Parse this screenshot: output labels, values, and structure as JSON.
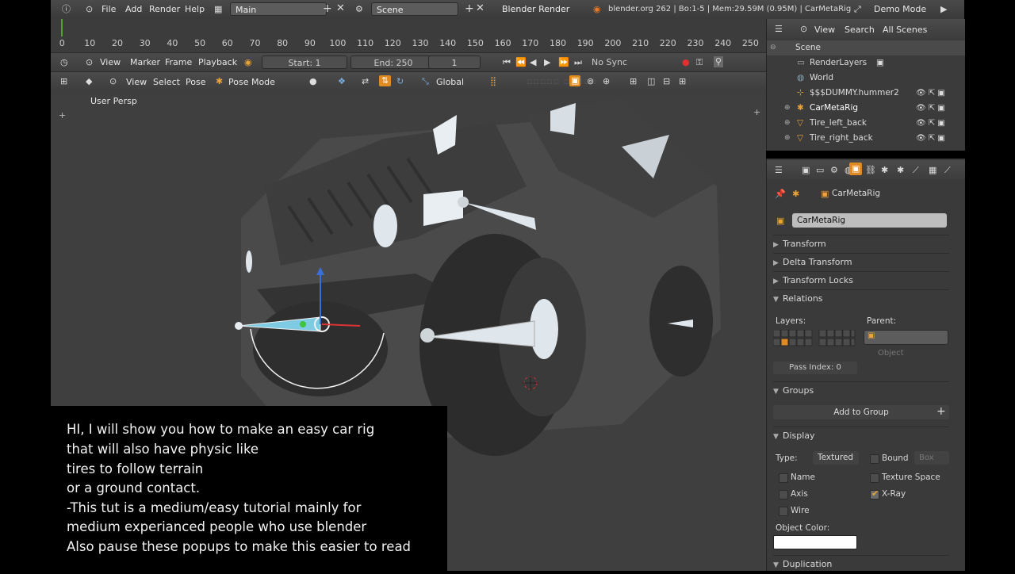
{
  "topbar": {
    "menus": [
      "File",
      "Add",
      "Render",
      "Help"
    ],
    "screen_layout": "Main",
    "scene": "Scene",
    "render_engine": "Blender Render",
    "stats": "blender.org 262 | Bo:1-5 | Mem:29.59M (0.95M) | CarMetaRig",
    "mode_label": "Demo Mode"
  },
  "timeline": {
    "ticks": [
      "0",
      "10",
      "20",
      "30",
      "40",
      "50",
      "60",
      "70",
      "80",
      "90",
      "100",
      "110",
      "120",
      "130",
      "140",
      "150",
      "160",
      "170",
      "180",
      "190",
      "200",
      "210",
      "220",
      "230",
      "240",
      "250"
    ],
    "menus": [
      "View",
      "Marker",
      "Frame",
      "Playback"
    ],
    "start": "Start: 1",
    "end": "End: 250",
    "current": "1",
    "sync": "No Sync"
  },
  "viewport_header": {
    "menus": [
      "View",
      "Select",
      "Pose"
    ],
    "mode": "Pose Mode",
    "orientation": "Global"
  },
  "viewport": {
    "label": "User Persp"
  },
  "subtitle": {
    "lines": [
      "HI,   I will show you how to make an easy car rig",
      "that will also have physic like",
      "tires to follow terrain",
      "or a ground contact.",
      "-This tut is a medium/easy tutorial mainly for",
      "medium experianced people who use blender",
      "Also pause these popups to make this easier to read"
    ]
  },
  "outliner": {
    "header": {
      "view": "View",
      "search": "Search",
      "filter": "All Scenes"
    },
    "items": [
      "Scene",
      "RenderLayers",
      "World",
      "$$$DUMMY.hummer2",
      "CarMetaRig",
      "Tire_left_back",
      "Tire_right_back"
    ]
  },
  "properties": {
    "breadcrumb": "CarMetaRig",
    "object_name": "CarMetaRig",
    "sections": {
      "transform": "Transform",
      "delta": "Delta Transform",
      "locks": "Transform Locks",
      "relations": "Relations",
      "groups": "Groups",
      "display": "Display",
      "duplication": "Duplication"
    },
    "relations": {
      "layers_label": "Layers:",
      "parent_label": "Parent:",
      "parent_type": "Object",
      "pass_index": "Pass Index: 0"
    },
    "groups": {
      "add": "Add to Group"
    },
    "display": {
      "type_label": "Type:",
      "type_value": "Textured",
      "bound_label": "Bound",
      "bound_value": "Box",
      "name": "Name",
      "texture_space": "Texture Space",
      "axis": "Axis",
      "xray": "X-Ray",
      "wire": "Wire",
      "object_color": "Object Color:"
    },
    "xray_checked": true,
    "object_color_hex": "#ffffff"
  },
  "colors": {
    "accent": "#e08a22",
    "bone": "#dfe8ec",
    "selected_bone": "#7ecbe3"
  }
}
